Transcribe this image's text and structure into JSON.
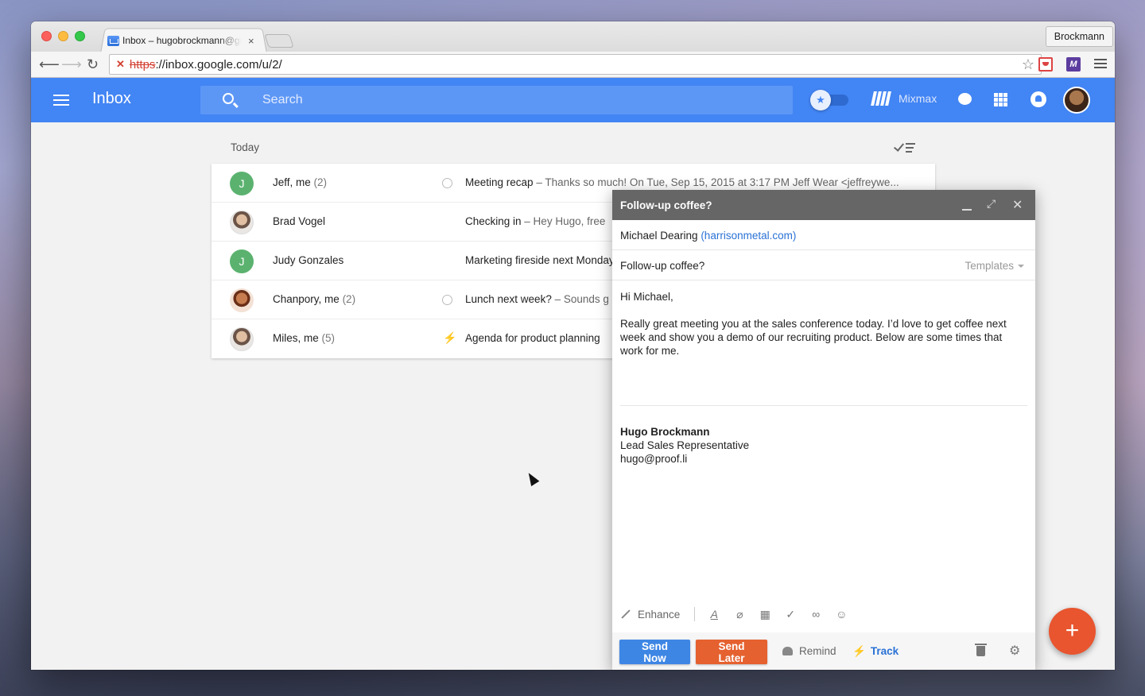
{
  "browser": {
    "tab_title": "Inbox – hugobrockmann@gmail.com",
    "tab_close": "×",
    "profile_name": "Brockmann",
    "url_scheme": "https",
    "url_rest": "://inbox.google.com/u/2/",
    "back": "⟵",
    "forward": "⟶",
    "reload": "↻",
    "star": "☆",
    "mixmax_ext": "M"
  },
  "app": {
    "title": "Inbox",
    "search_placeholder": "Search",
    "pin_glyph": "📌",
    "mixmax_label": "Mixmax",
    "accent": "#4285f4"
  },
  "list": {
    "section": "Today",
    "rows": [
      {
        "avatar_letter": "J",
        "name": "Jeff, me",
        "count": "(2)",
        "subject": "Meeting recap",
        "snippet": " – Thanks so much! On Tue, Sep 15, 2015 at 3:17 PM Jeff Wear <jeffreywe..."
      },
      {
        "avatar_letter": "",
        "name": "Brad Vogel",
        "count": "",
        "subject": "Checking in",
        "snippet": " – Hey Hugo, free"
      },
      {
        "avatar_letter": "J",
        "name": "Judy Gonzales",
        "count": "",
        "subject": "Marketing fireside next Monday",
        "snippet": ""
      },
      {
        "avatar_letter": "",
        "name": "Chanpory, me",
        "count": "(2)",
        "subject": "Lunch next week?",
        "snippet": " – Sounds g"
      },
      {
        "avatar_letter": "",
        "name": "Miles, me",
        "count": "(5)",
        "subject": "Agenda for product planning",
        "snippet": ""
      }
    ]
  },
  "compose": {
    "title": "Follow-up coffee?",
    "to_name": "Michael Dearing",
    "to_domain": "(harrisonmetal.com)",
    "subject": "Follow-up coffee?",
    "templates_label": "Templates",
    "greeting": "Hi Michael,",
    "body": "Really great meeting you at the sales conference today. I’d love to get coffee next week and show you a demo of our recruiting product. Below are some times that work for me.",
    "signature_name": "Hugo Brockmann",
    "signature_title": "Lead Sales Representative",
    "signature_email": "hugo@proof.li",
    "enhance_label": "Enhance",
    "send_now": "Send Now",
    "send_later": "Send Later",
    "remind": "Remind",
    "track": "Track",
    "minimize": "",
    "expand": "⤢",
    "close": "✕",
    "send_now_color": "#3e86e4",
    "send_later_color": "#e5612f"
  },
  "fab": {
    "glyph": "+",
    "color": "#e8552f"
  }
}
